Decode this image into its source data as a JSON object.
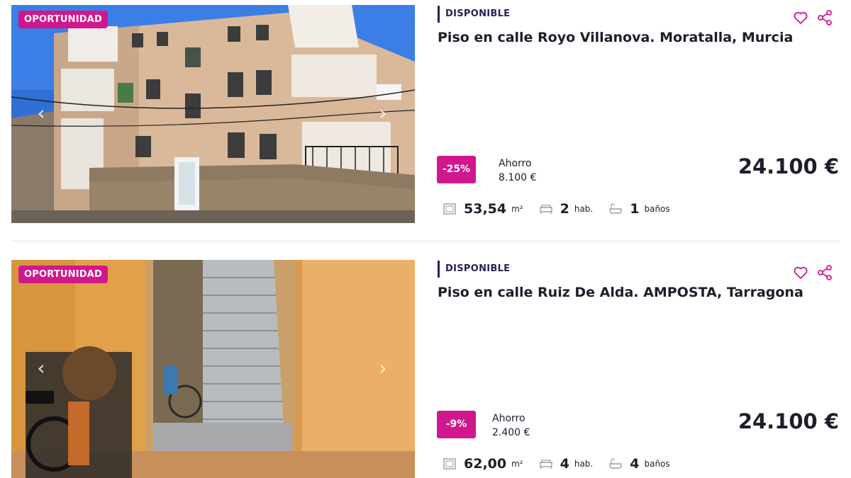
{
  "listings": [
    {
      "badge": "OPORTUNIDAD",
      "status": "DISPONIBLE",
      "title": "Piso en calle Royo Villanova. Moratalla, Murcia",
      "discount": "-25%",
      "savings_label": "Ahorro",
      "savings_amount": "8.100 €",
      "price": "24.100 €",
      "area_value": "53,54",
      "area_unit": "m²",
      "rooms_value": "2",
      "rooms_unit": "hab.",
      "baths_value": "1",
      "baths_unit": "baños",
      "photo_icon": "building-facade-photo"
    },
    {
      "badge": "OPORTUNIDAD",
      "status": "DISPONIBLE",
      "title": "Piso en calle Ruiz De Alda. AMPOSTA, Tarragona",
      "discount": "-9%",
      "savings_label": "Ahorro",
      "savings_amount": "2.400 €",
      "price": "24.100 €",
      "area_value": "62,00",
      "area_unit": "m²",
      "rooms_value": "4",
      "rooms_unit": "hab.",
      "baths_value": "4",
      "baths_unit": "baños",
      "photo_icon": "interior-staircase-photo"
    }
  ],
  "colors": {
    "accent": "#d1178d",
    "status": "#24245a",
    "text": "#1d1d2b"
  },
  "icons": {
    "favorite": "heart-icon",
    "share": "share-icon",
    "prev": "chevron-left-icon",
    "next": "chevron-right-icon",
    "area": "area-icon",
    "rooms": "bed-icon",
    "baths": "bathtub-icon"
  }
}
